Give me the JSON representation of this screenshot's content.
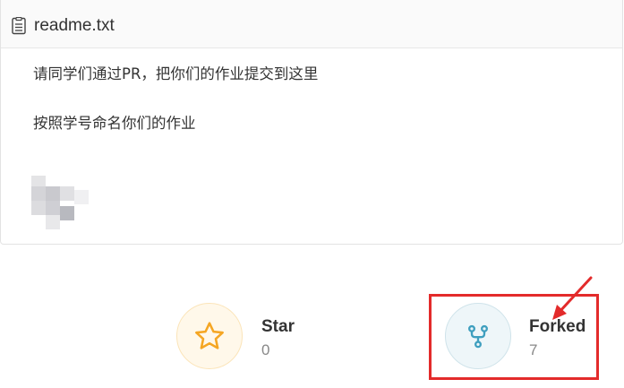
{
  "readme": {
    "file_icon": "file-text-icon",
    "file_name": "readme.txt",
    "lines": [
      "请同学们通过PR，把你们的作业提交到这里",
      "按照学号命名你们的作业"
    ]
  },
  "stats": {
    "star": {
      "icon": "star-icon",
      "label": "Star",
      "count": "0",
      "color": "#f5a623"
    },
    "fork": {
      "icon": "fork-icon",
      "label": "Forked",
      "count": "7",
      "color": "#3f9fbf"
    }
  },
  "annotation": {
    "color": "#e32b2b"
  }
}
